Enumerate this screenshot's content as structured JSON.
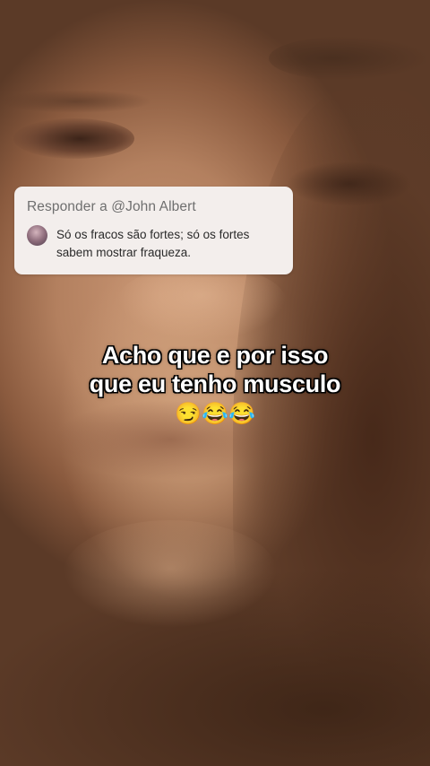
{
  "reply": {
    "header": "Responder a @John Albert",
    "comment": "Só os fracos são fortes; só os fortes\nsabem mostrar  fraqueza."
  },
  "caption": {
    "line1": "Acho que e por isso",
    "line2": "que eu tenho musculo"
  },
  "emojis": "😏😂😂"
}
